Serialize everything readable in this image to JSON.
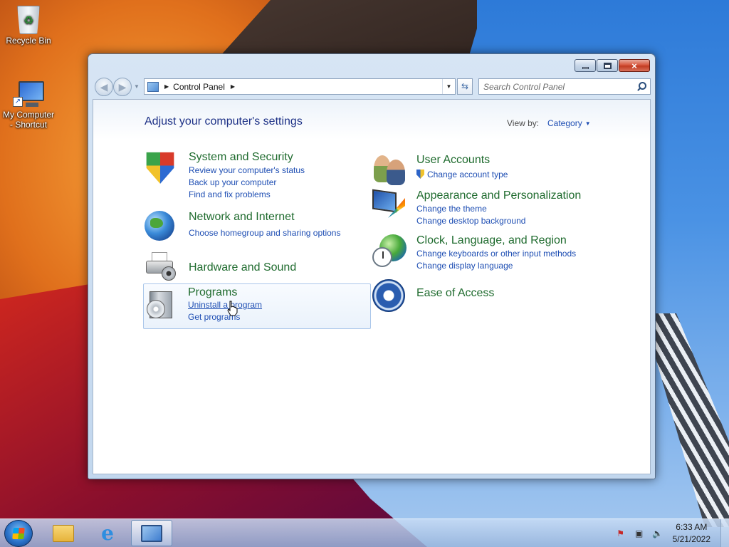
{
  "desktop": {
    "icons": [
      {
        "label": "Recycle Bin"
      },
      {
        "label_line1": "My Computer",
        "label_line2": "- Shortcut"
      }
    ]
  },
  "window": {
    "address": {
      "root_label": "Control Panel"
    },
    "search": {
      "placeholder": "Search Control Panel"
    },
    "caption": {
      "minimize": "minimize-icon",
      "maximize": "maximize-icon",
      "close": "×"
    },
    "heading": "Adjust your computer's settings",
    "view_by": {
      "label": "View by:",
      "value": "Category"
    },
    "categories_left": [
      {
        "title": "System and Security",
        "links": [
          "Review your computer's status",
          "Back up your computer",
          "Find and fix problems"
        ]
      },
      {
        "title": "Network and Internet",
        "links": [
          "Choose homegroup and sharing options"
        ]
      },
      {
        "title": "Hardware and Sound",
        "links": []
      },
      {
        "title": "Programs",
        "links": [
          "Uninstall a program",
          "Get programs"
        ]
      }
    ],
    "categories_right": [
      {
        "title": "User Accounts",
        "links": [
          "Change account type"
        ]
      },
      {
        "title": "Appearance and Personalization",
        "links": [
          "Change the theme",
          "Change desktop background"
        ]
      },
      {
        "title": "Clock, Language, and Region",
        "links": [
          "Change keyboards or other input methods",
          "Change display language"
        ]
      },
      {
        "title": "Ease of Access",
        "links": []
      }
    ]
  },
  "taskbar": {
    "pinned": [
      "windows-explorer-icon",
      "internet-explorer-icon",
      "control-panel-icon"
    ],
    "clock": {
      "time": "6:33 AM",
      "date": "5/21/2022"
    }
  },
  "colors": {
    "category_title": "#1f6b2e",
    "link": "#1e4eb3",
    "heading": "#1e3287"
  }
}
